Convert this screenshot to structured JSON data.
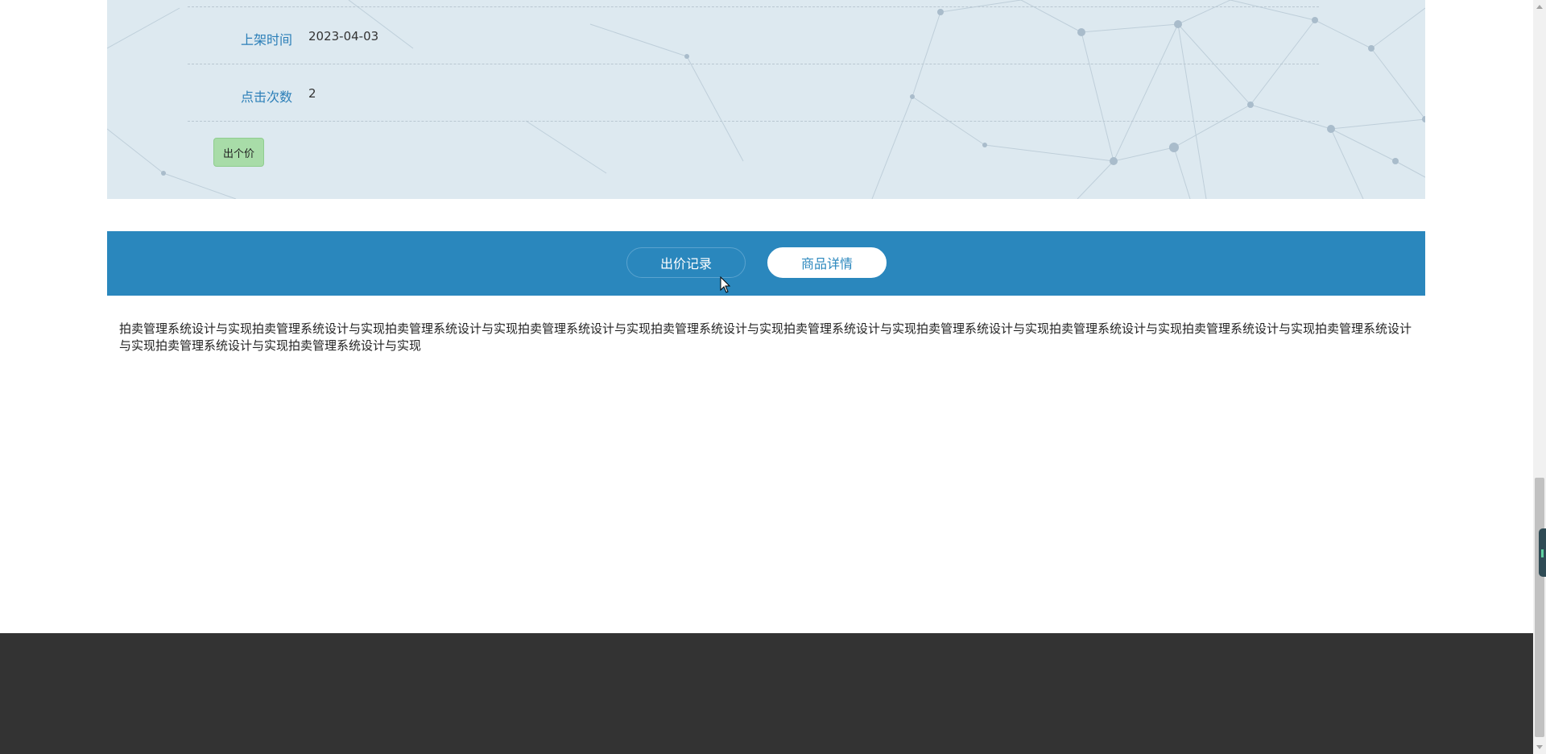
{
  "info": {
    "rows": [
      {
        "label": "上架时间",
        "value": "2023-04-03"
      },
      {
        "label": "点击次数",
        "value": "2"
      }
    ],
    "bid_button": "出个价"
  },
  "tabs": {
    "bid_records": "出价记录",
    "product_detail": "商品详情"
  },
  "detail": {
    "text": "拍卖管理系统设计与实现拍卖管理系统设计与实现拍卖管理系统设计与实现拍卖管理系统设计与实现拍卖管理系统设计与实现拍卖管理系统设计与实现拍卖管理系统设计与实现拍卖管理系统设计与实现拍卖管理系统设计与实现拍卖管理系统设计与实现拍卖管理系统设计与实现拍卖管理系统设计与实现"
  },
  "colors": {
    "accent": "#2a87bd",
    "panel_bg": "#dde9f0",
    "bid_button_bg": "#a8dca8",
    "footer_bg": "#333333"
  },
  "icons": {
    "cursor": "mouse-pointer-icon",
    "side_widget": "side-widget-icon"
  }
}
